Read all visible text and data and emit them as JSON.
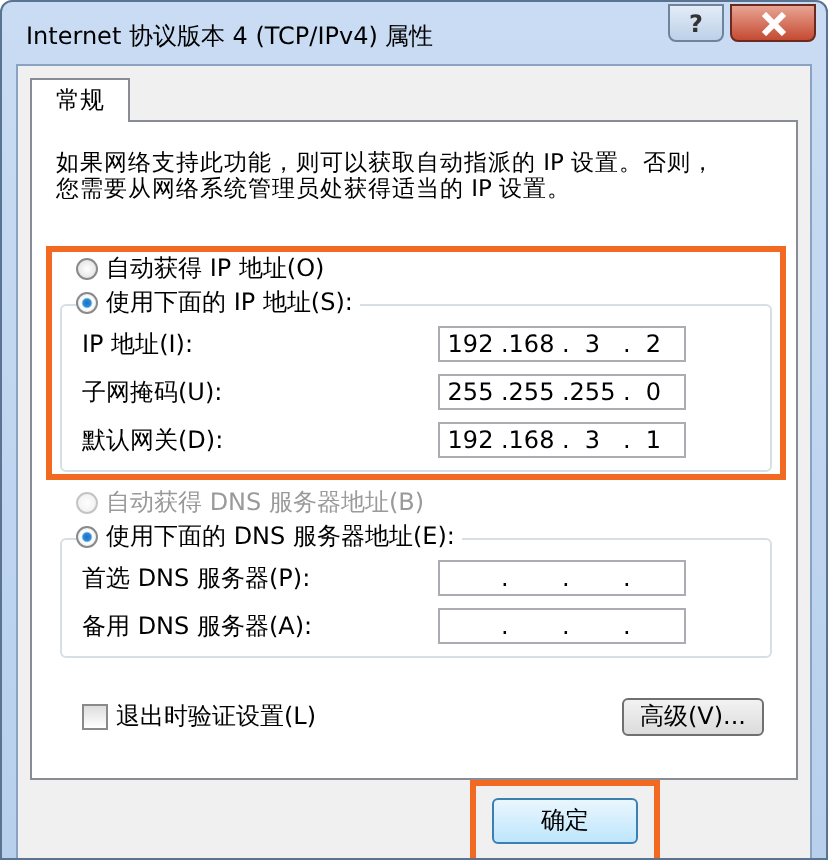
{
  "window": {
    "title": "Internet 协议版本 4 (TCP/IPv4) 属性",
    "help_button": "?"
  },
  "tabs": [
    {
      "label": "常规",
      "selected": true
    }
  ],
  "description_lines": [
    "如果网络支持此功能，则可以获取自动指派的 IP 设置。否则，",
    "您需要从网络系统管理员处获得适当的 IP 设置。"
  ],
  "ip_group": {
    "highlighted": true,
    "options": [
      {
        "label": "自动获得 IP 地址(O)",
        "selected": false,
        "disabled": false
      },
      {
        "label": "使用下面的 IP 地址(S):",
        "selected": true,
        "disabled": false
      }
    ],
    "fields": [
      {
        "label": "IP 地址(I):",
        "octets": [
          "192",
          "168",
          "3",
          "2"
        ],
        "dots": [
          ".",
          ".",
          "."
        ]
      },
      {
        "label": "子网掩码(U):",
        "octets": [
          "255",
          "255",
          "255",
          "0"
        ],
        "dots": [
          ".",
          ".",
          "."
        ]
      },
      {
        "label": "默认网关(D):",
        "octets": [
          "192",
          "168",
          "3",
          "1"
        ],
        "dots": [
          ".",
          ".",
          "."
        ]
      }
    ]
  },
  "dns_group": {
    "highlighted": false,
    "options": [
      {
        "label": "自动获得 DNS 服务器地址(B)",
        "selected": false,
        "disabled": true
      },
      {
        "label": "使用下面的 DNS 服务器地址(E):",
        "selected": true,
        "disabled": false
      }
    ],
    "fields": [
      {
        "label": "首选 DNS 服务器(P):",
        "dots": [
          ".",
          ".",
          "."
        ]
      },
      {
        "label": "备用 DNS 服务器(A):",
        "dots": [
          ".",
          ".",
          "."
        ]
      }
    ]
  },
  "validate_checkbox": {
    "label": "退出时验证设置(L)",
    "checked": false
  },
  "advanced_button": "高级(V)...",
  "ok_button": {
    "label": "确定",
    "highlighted": true
  }
}
